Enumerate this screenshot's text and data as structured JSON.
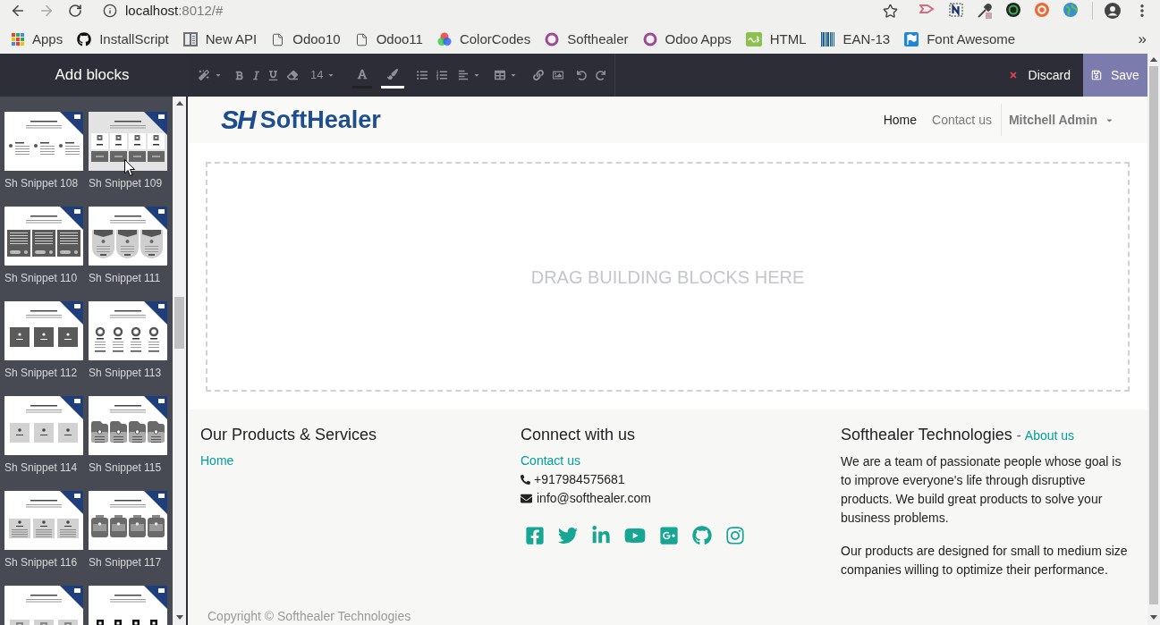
{
  "browser": {
    "back": {
      "disabled": false
    },
    "forward": {
      "disabled": true
    },
    "url_host": "localhost",
    "url_path": ":8012/#"
  },
  "bookmarks": {
    "items": [
      {
        "label": "Apps",
        "kind": "apps"
      },
      {
        "label": "InstallScript",
        "kind": "github"
      },
      {
        "label": "New API",
        "kind": "book"
      },
      {
        "label": "Odoo10",
        "kind": "page"
      },
      {
        "label": "Odoo11",
        "kind": "page"
      },
      {
        "label": "ColorCodes",
        "kind": "colors"
      },
      {
        "label": "Softhealer",
        "kind": "ring"
      },
      {
        "label": "Odoo Apps",
        "kind": "ring"
      },
      {
        "label": "HTML",
        "kind": "html"
      },
      {
        "label": "EAN-13",
        "kind": "barcode"
      },
      {
        "label": "Font Awesome",
        "kind": "flag"
      }
    ],
    "more": "»"
  },
  "sidebar": {
    "title": "Add blocks",
    "snippets": [
      {
        "label": "Sh Snippet 108",
        "kind": "dots"
      },
      {
        "label": "Sh Snippet 109",
        "kind": "grid"
      },
      {
        "label": "Sh Snippet 110",
        "kind": "cards"
      },
      {
        "label": "Sh Snippet 111",
        "kind": "shields"
      },
      {
        "label": "Sh Snippet 112",
        "kind": "tiles"
      },
      {
        "label": "Sh Snippet 113",
        "kind": "circles"
      },
      {
        "label": "Sh Snippet 114",
        "kind": "lighttiles"
      },
      {
        "label": "Sh Snippet 115",
        "kind": "folders"
      },
      {
        "label": "Sh Snippet 116",
        "kind": "listtiles"
      },
      {
        "label": "Sh Snippet 117",
        "kind": "badges"
      },
      {
        "kind": "squares"
      },
      {
        "kind": "icons"
      }
    ]
  },
  "toolbar": {
    "font_size": "14",
    "color_pickers": [
      {
        "kind": "text",
        "color": "#222222"
      },
      {
        "kind": "background",
        "color": "#ffffff"
      }
    ],
    "discard": "Discard",
    "save": "Save"
  },
  "navbar": {
    "logo_mark": "SH",
    "brand": "SoftHealer",
    "items": [
      {
        "label": "Home",
        "selected": true
      },
      {
        "label": "Contact us",
        "selected": false
      }
    ],
    "user_menu": "Mitchell Admin"
  },
  "drop_zone": {
    "text": "DRAG BUILDING BLOCKS HERE"
  },
  "footer": {
    "products": {
      "title": "Our Products & Services",
      "links": [
        "Home"
      ]
    },
    "connect": {
      "title": "Connect with us",
      "link": "Contact us",
      "phone": "+917984575681",
      "email": "info@softhealer.com"
    },
    "about": {
      "title": "Softhealer Technologies",
      "separator": "-",
      "link": "About us",
      "paragraphs": [
        "We are a team of passionate people whose goal is to improve everyone's life through disruptive products. We build great products to solve your business problems.",
        "Our products are designed for small to medium size companies willing to optimize their performance."
      ]
    }
  },
  "copyright": "Copyright © Softhealer Technologies"
}
